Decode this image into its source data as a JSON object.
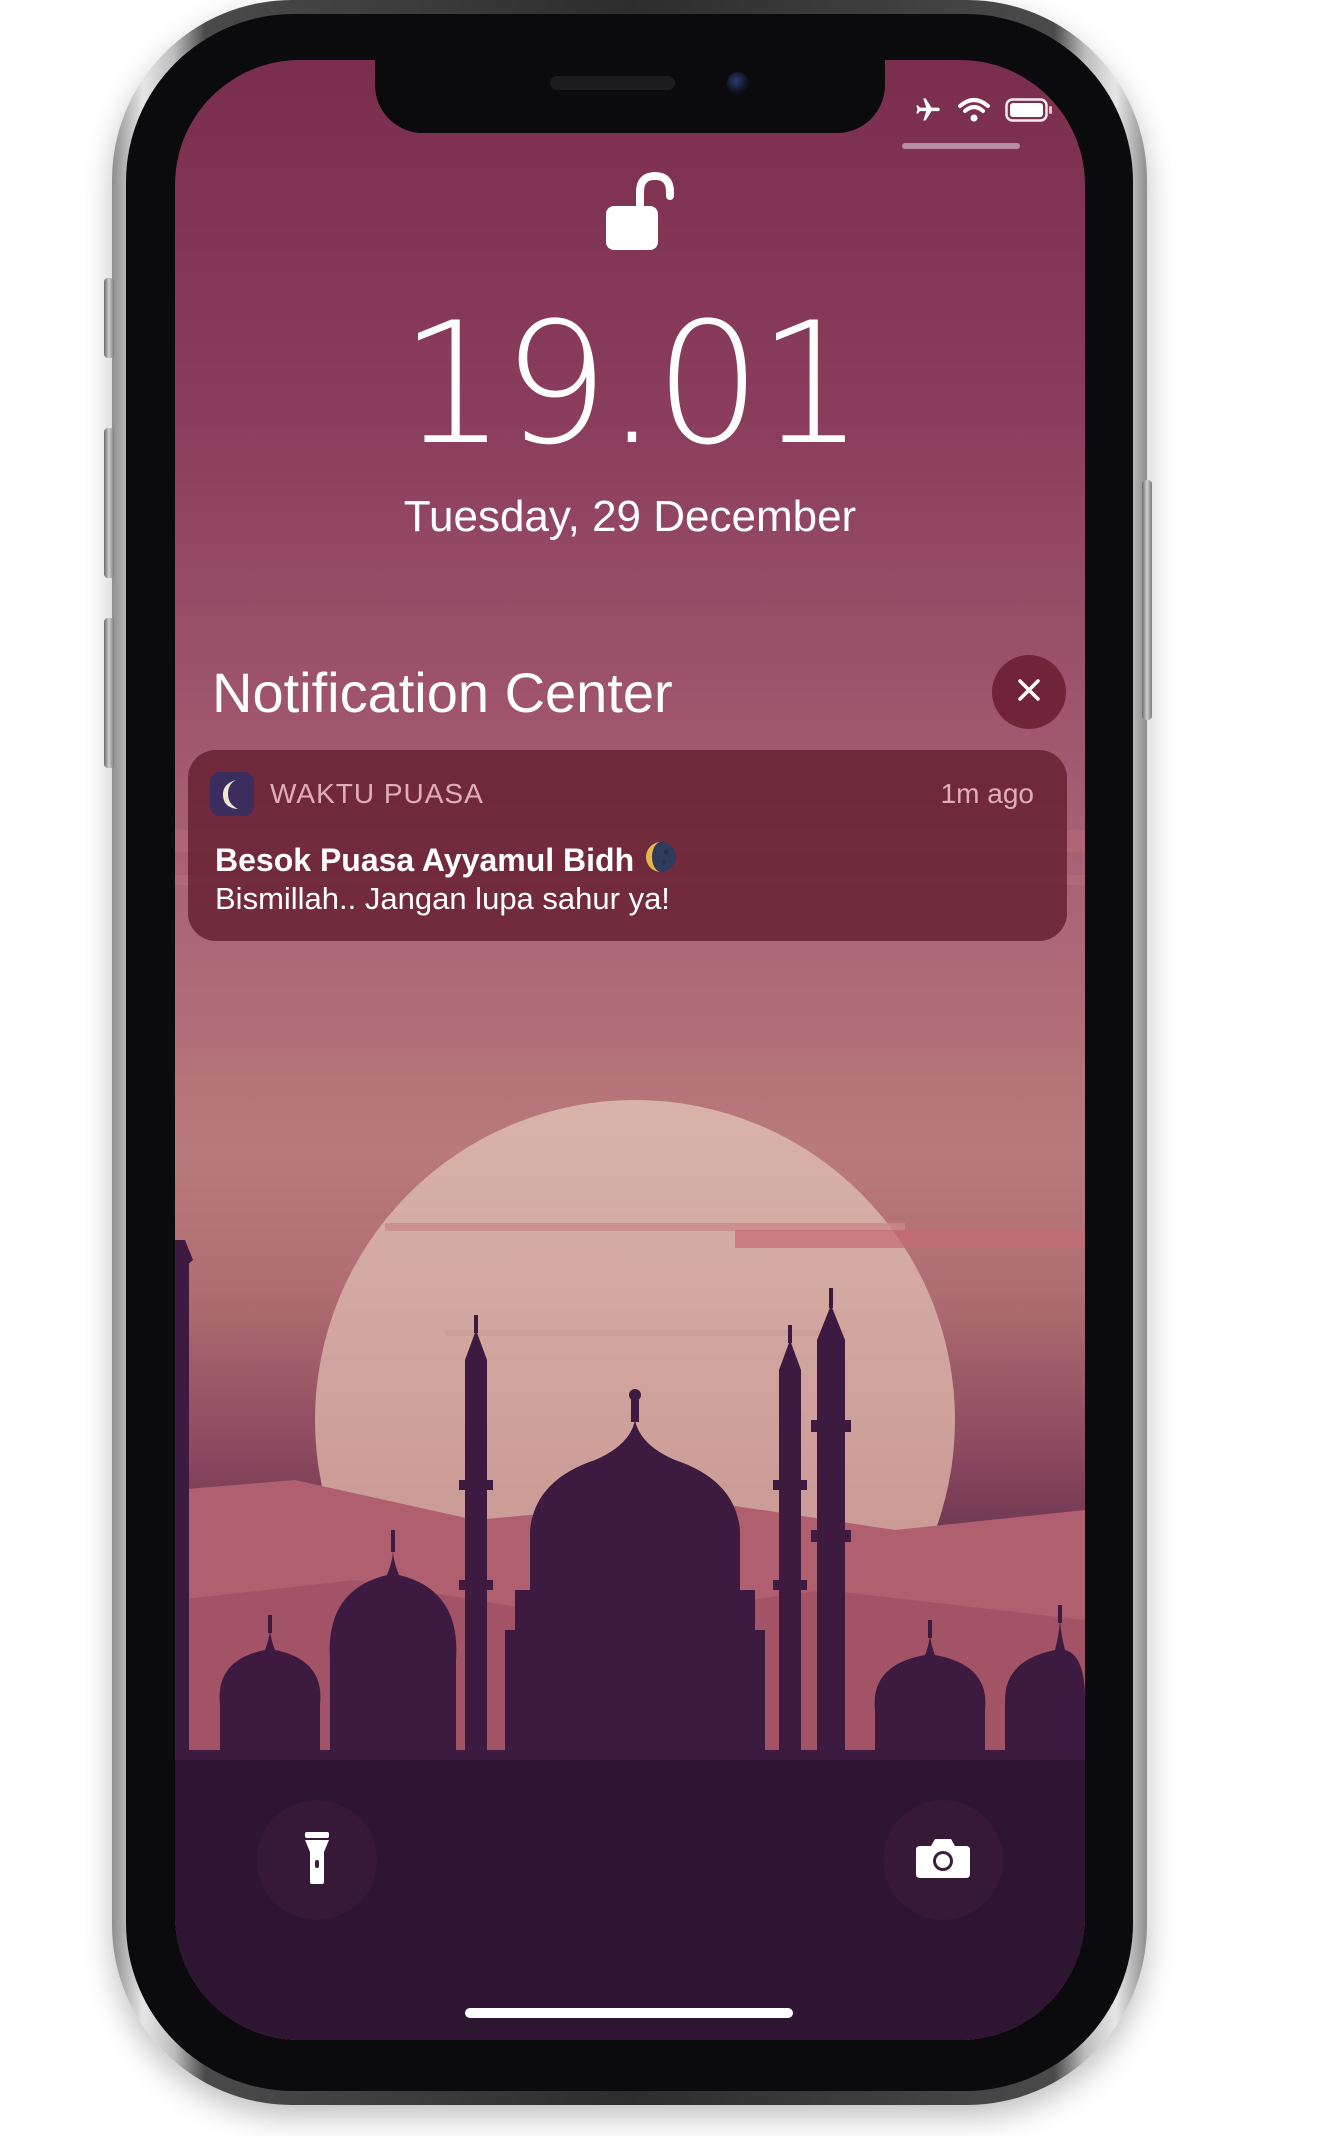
{
  "status_bar": {
    "icons": [
      "airplane-icon",
      "wifi-icon",
      "battery-icon"
    ]
  },
  "lock_screen": {
    "lock_state_icon": "unlocked-padlock-icon",
    "time": "19.01",
    "date": "Tuesday, 29 December"
  },
  "notification_center": {
    "title": "Notification Center",
    "close_icon": "close-icon"
  },
  "notification": {
    "app_icon": "crescent-moon-icon",
    "app_name": "WAKTU PUASA",
    "time_ago": "1m ago",
    "title": "Besok Puasa Ayyamul Bidh",
    "title_emoji_icon": "full-moon-emoji-icon",
    "body": "Bismillah.. Jangan lupa sahur ya!"
  },
  "quick_actions": {
    "left_icon": "flashlight-icon",
    "right_icon": "camera-icon"
  },
  "colors": {
    "wallpaper_top": "#7a2d4d",
    "wallpaper_mid": "#b87a7c",
    "mosque_silhouette": "#3d1a3f",
    "notification_bg": "#641e30",
    "sun": "#d9b0a8"
  }
}
